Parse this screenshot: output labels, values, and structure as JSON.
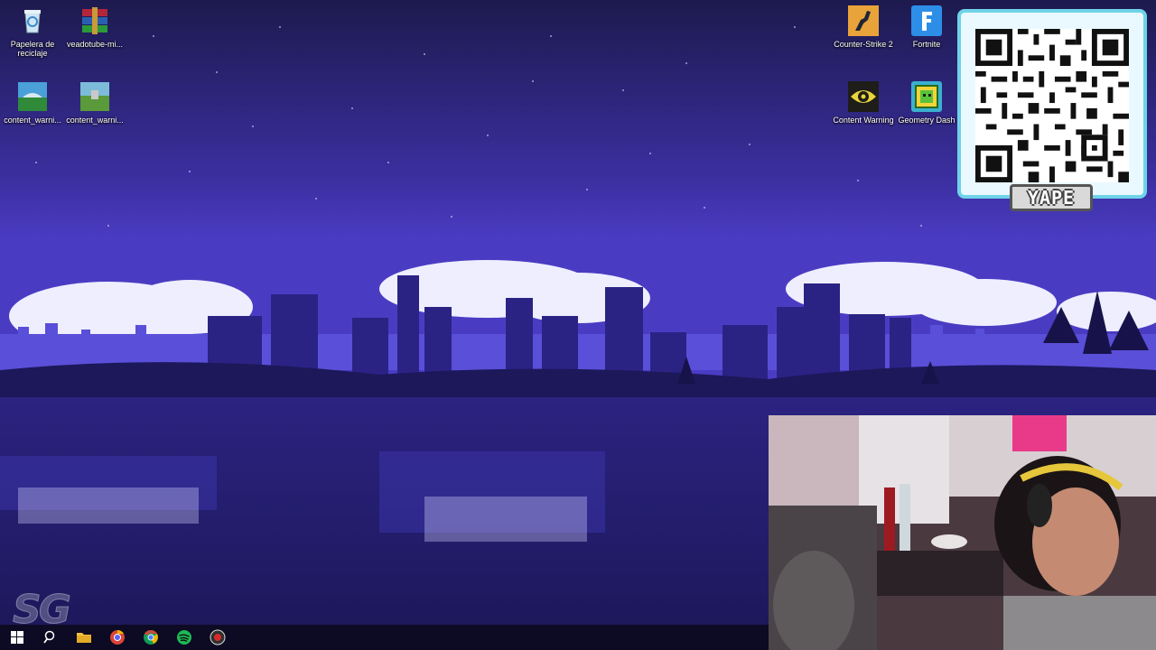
{
  "desktop": {
    "icons": [
      {
        "label": "Papelera de reciclaje",
        "icon": "recycle-bin-icon"
      },
      {
        "label": "veadotube-mi...",
        "icon": "winrar-archive-icon"
      },
      {
        "label": "content_warni...",
        "icon": "content-warning-shortcut-icon"
      },
      {
        "label": "content_warni...",
        "icon": "content-warning-shortcut-icon"
      },
      {
        "label": "Counter-Strike 2",
        "icon": "counter-strike-icon"
      },
      {
        "label": "Fortnite",
        "icon": "fortnite-icon"
      },
      {
        "label": "Content Warning",
        "icon": "content-warning-eye-icon"
      },
      {
        "label": "Geometry Dash",
        "icon": "geometry-dash-icon"
      }
    ]
  },
  "overlay": {
    "qr_label": "YAPE",
    "watermark": "SG",
    "colors": {
      "qr_border": "#6fd3e8",
      "qr_bg": "#e9f9ff"
    }
  },
  "taskbar": {
    "items": [
      "start-icon",
      "search-icon",
      "file-explorer-icon",
      "discord-chrome-icon",
      "chrome-icon",
      "spotify-icon",
      "recorder-icon"
    ]
  }
}
